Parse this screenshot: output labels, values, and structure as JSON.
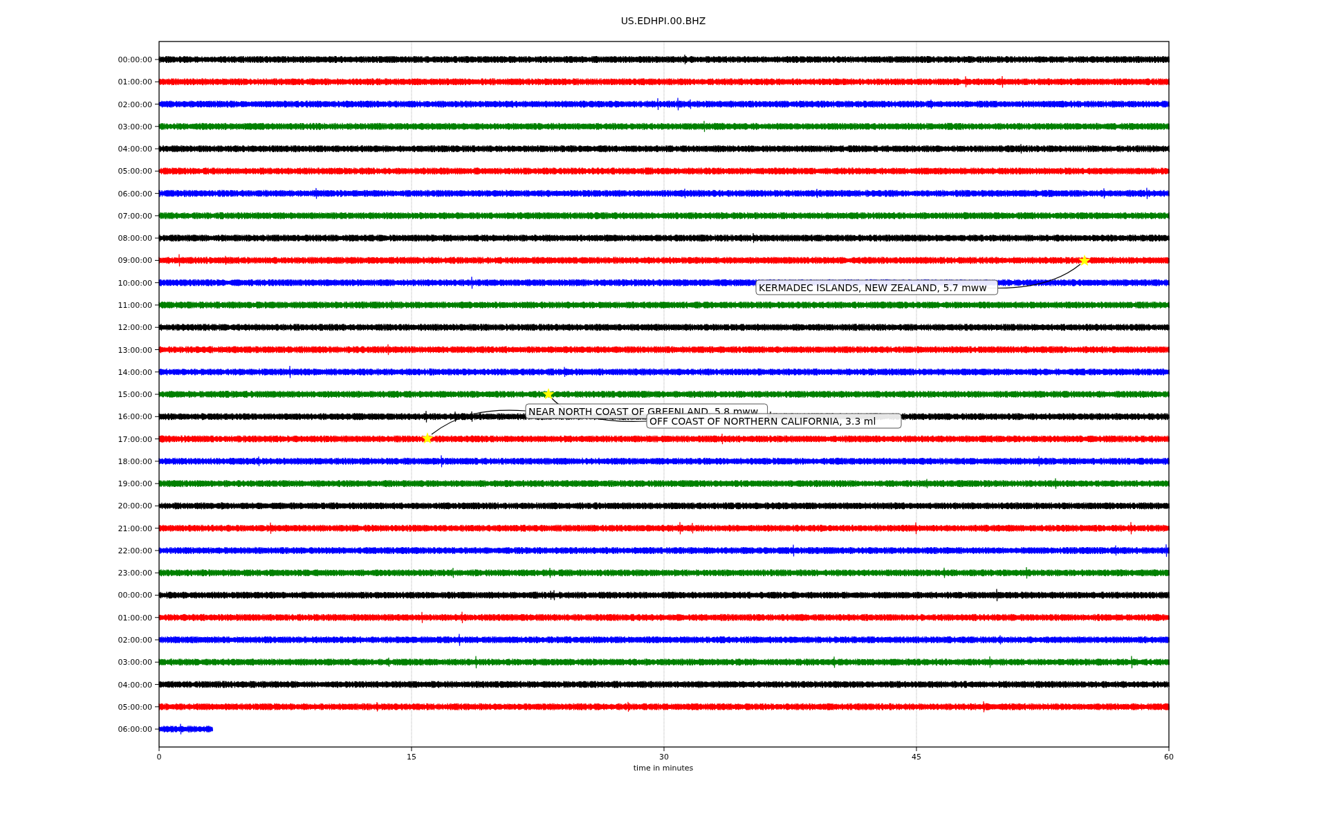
{
  "figure": {
    "title": "US.EDHPI.00.BHZ"
  },
  "plot": {
    "xlabel": "time in minutes",
    "xticks": [
      "0",
      "15",
      "30",
      "45",
      "60"
    ],
    "rows": [
      {
        "label": "00:00:00",
        "color": "#000000",
        "level": 1
      },
      {
        "label": "01:00:00",
        "color": "#ff0000",
        "level": 1
      },
      {
        "label": "02:00:00",
        "color": "#0000ff",
        "level": 1
      },
      {
        "label": "03:00:00",
        "color": "#008000",
        "level": 1
      },
      {
        "label": "04:00:00",
        "color": "#000000",
        "level": 1
      },
      {
        "label": "05:00:00",
        "color": "#ff0000",
        "level": 1
      },
      {
        "label": "06:00:00",
        "color": "#0000ff",
        "level": 1
      },
      {
        "label": "07:00:00",
        "color": "#008000",
        "level": 1
      },
      {
        "label": "08:00:00",
        "color": "#000000",
        "level": 1
      },
      {
        "label": "09:00:00",
        "color": "#ff0000",
        "level": 1
      },
      {
        "label": "10:00:00",
        "color": "#0000ff",
        "level": 1
      },
      {
        "label": "11:00:00",
        "color": "#008000",
        "level": 1
      },
      {
        "label": "12:00:00",
        "color": "#000000",
        "level": 1
      },
      {
        "label": "13:00:00",
        "color": "#ff0000",
        "level": 1
      },
      {
        "label": "14:00:00",
        "color": "#0000ff",
        "level": 1
      },
      {
        "label": "15:00:00",
        "color": "#008000",
        "level": 1
      },
      {
        "label": "16:00:00",
        "color": "#000000",
        "level": 1
      },
      {
        "label": "17:00:00",
        "color": "#ff0000",
        "level": 1
      },
      {
        "label": "18:00:00",
        "color": "#0000ff",
        "level": 1
      },
      {
        "label": "19:00:00",
        "color": "#008000",
        "level": 1
      },
      {
        "label": "20:00:00",
        "color": "#000000",
        "level": 1
      },
      {
        "label": "21:00:00",
        "color": "#ff0000",
        "level": 1
      },
      {
        "label": "22:00:00",
        "color": "#0000ff",
        "level": 1
      },
      {
        "label": "23:00:00",
        "color": "#008000",
        "level": 1
      },
      {
        "label": "00:00:00",
        "color": "#000000",
        "level": 1
      },
      {
        "label": "01:00:00",
        "color": "#ff0000",
        "level": 1
      },
      {
        "label": "02:00:00",
        "color": "#0000ff",
        "level": 1
      },
      {
        "label": "03:00:00",
        "color": "#008000",
        "level": 1
      },
      {
        "label": "04:00:00",
        "color": "#000000",
        "level": 1
      },
      {
        "label": "05:00:00",
        "color": "#ff0000",
        "level": 1
      },
      {
        "label": "06:00:00",
        "color": "#0000ff",
        "level": 0.053
      }
    ],
    "events": [
      {
        "text": "KERMADEC ISLANDS, NEW ZEALAND, 5.7 mww"
      },
      {
        "text": "NEAR NORTH COAST OF GREENLAND, 5.8 mww"
      },
      {
        "text": "OFF COAST OF NORTHERN CALIFORNIA, 3.3 ml"
      }
    ]
  }
}
